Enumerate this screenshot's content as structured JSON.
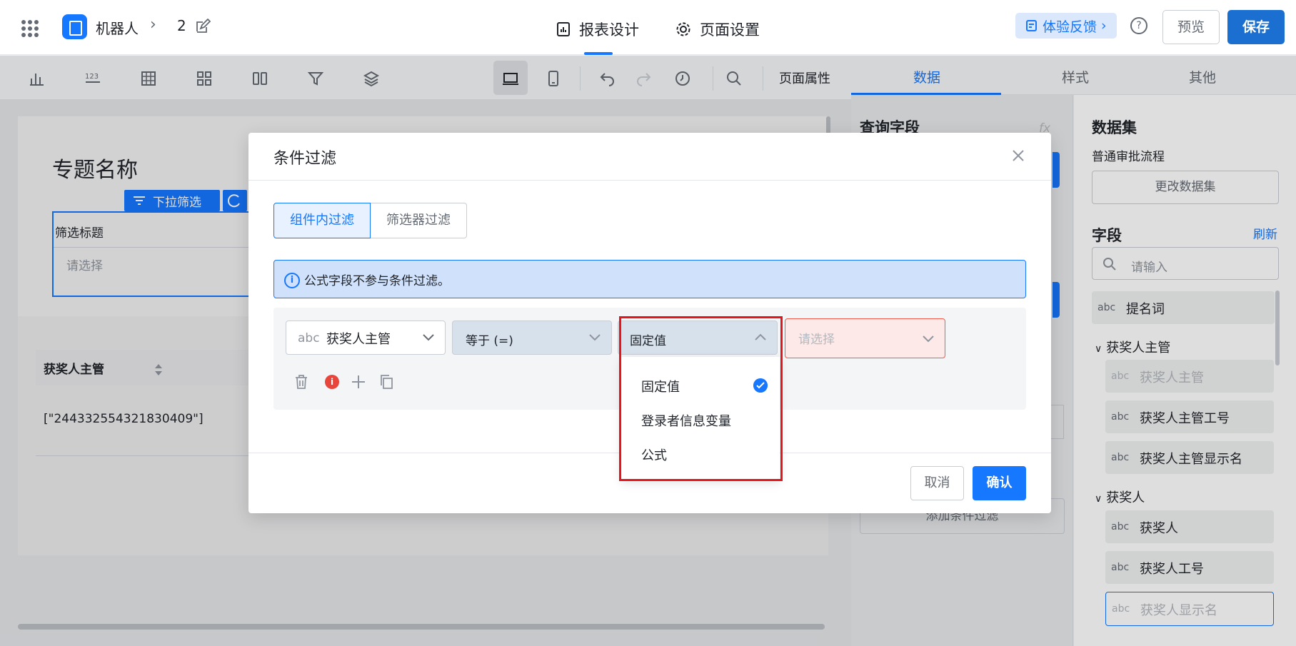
{
  "header": {
    "app_name": "机器人",
    "breadcrumb_num": "2",
    "tab_design": "报表设计",
    "tab_page": "页面设置",
    "feedback": "体验反馈",
    "help": "?",
    "preview": "预览",
    "save": "保存"
  },
  "toolbar": {
    "page_props": "页面属性"
  },
  "canvas": {
    "topic_title": "专题名称",
    "filter_tag": "下拉筛选",
    "filter_title": "筛选标题",
    "filter_placeholder": "请选择",
    "table_header": "获奖人主管",
    "table_cell": "[\"244332554321830409\"]"
  },
  "right_tabs": [
    "数据",
    "样式",
    "其他"
  ],
  "mid_panel": {
    "title": "查询字段",
    "fx": "fx",
    "add_condition": "添加条件过滤"
  },
  "dataset": {
    "title": "数据集",
    "name": "普通审批流程",
    "change_btn": "更改数据集",
    "field_title": "字段",
    "refresh": "刷新",
    "search_placeholder": "请输入",
    "items": [
      {
        "abc": "abc",
        "name": "提名词"
      },
      {
        "group": "获奖人主管"
      },
      {
        "abc": "abc",
        "name": "获奖人主管"
      },
      {
        "abc": "abc",
        "name": "获奖人主管工号"
      },
      {
        "abc": "abc",
        "name": "获奖人主管显示名"
      },
      {
        "group": "获奖人"
      },
      {
        "abc": "abc",
        "name": "获奖人"
      },
      {
        "abc": "abc",
        "name": "获奖人工号"
      },
      {
        "abc": "abc",
        "name": "获奖人显示名"
      }
    ]
  },
  "modal": {
    "title": "条件过滤",
    "seg_on": "组件内过滤",
    "seg_off": "筛选器过滤",
    "info": "公式字段不参与条件过滤。",
    "field_abc": "abc",
    "field_value": "获奖人主管",
    "operator": "等于 (=)",
    "value_type": "固定值",
    "value_placeholder": "请选择",
    "error_badge": "i",
    "cancel": "取消",
    "confirm": "确认",
    "dropdown": [
      "固定值",
      "登录者信息变量",
      "公式"
    ]
  },
  "colors": {
    "accent": "#1677ff",
    "highlight_frame": "#e6141b"
  }
}
